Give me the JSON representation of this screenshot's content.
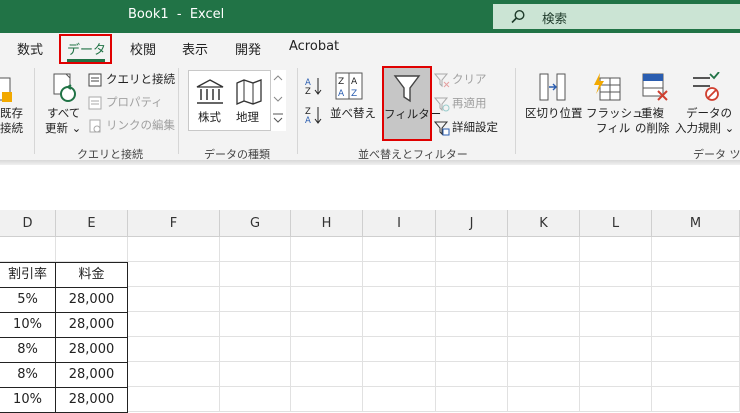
{
  "titlebar": {
    "title": "Book1  -  Excel",
    "search_label": "検索"
  },
  "tabs": [
    {
      "label": "数式"
    },
    {
      "label": "データ",
      "active": true
    },
    {
      "label": "校閲"
    },
    {
      "label": "表示"
    },
    {
      "label": "開発"
    },
    {
      "label": "Acrobat"
    }
  ],
  "ribbon": {
    "get_data": {
      "line1": "既存",
      "line2": "接続"
    },
    "queries": {
      "refresh_all_line1": "すべて",
      "refresh_all_line2": "更新 ⌄",
      "queries_connections": "クエリと接続",
      "properties": "プロパティ",
      "edit_links": "リンクの編集",
      "group_label": "クエリと接続"
    },
    "data_types": {
      "stocks": "株式",
      "geography": "地理",
      "group_label": "データの種類"
    },
    "sort_filter": {
      "sort": "並べ替え",
      "filter": "フィルター",
      "clear": "クリア",
      "reapply": "再適用",
      "advanced": "詳細設定",
      "group_label": "並べ替えとフィルター"
    },
    "data_tools": {
      "text_to_columns": "区切り位置",
      "flash_fill_line1": "フラッシュ",
      "flash_fill_line2": "フィル",
      "remove_dup_line1": "重複",
      "remove_dup_line2": "の削除",
      "validation_line1": "データの",
      "validation_line2": "入力規則 ⌄",
      "group_label": "データ ツー"
    }
  },
  "grid": {
    "columns": [
      "D",
      "E",
      "F",
      "G",
      "H",
      "I",
      "J",
      "K",
      "L",
      "M"
    ],
    "table": {
      "headers": [
        "割引率",
        "料金"
      ],
      "rows": [
        [
          "5%",
          "28,000"
        ],
        [
          "10%",
          "28,000"
        ],
        [
          "8%",
          "28,000"
        ],
        [
          "8%",
          "28,000"
        ],
        [
          "10%",
          "28,000"
        ]
      ]
    }
  }
}
